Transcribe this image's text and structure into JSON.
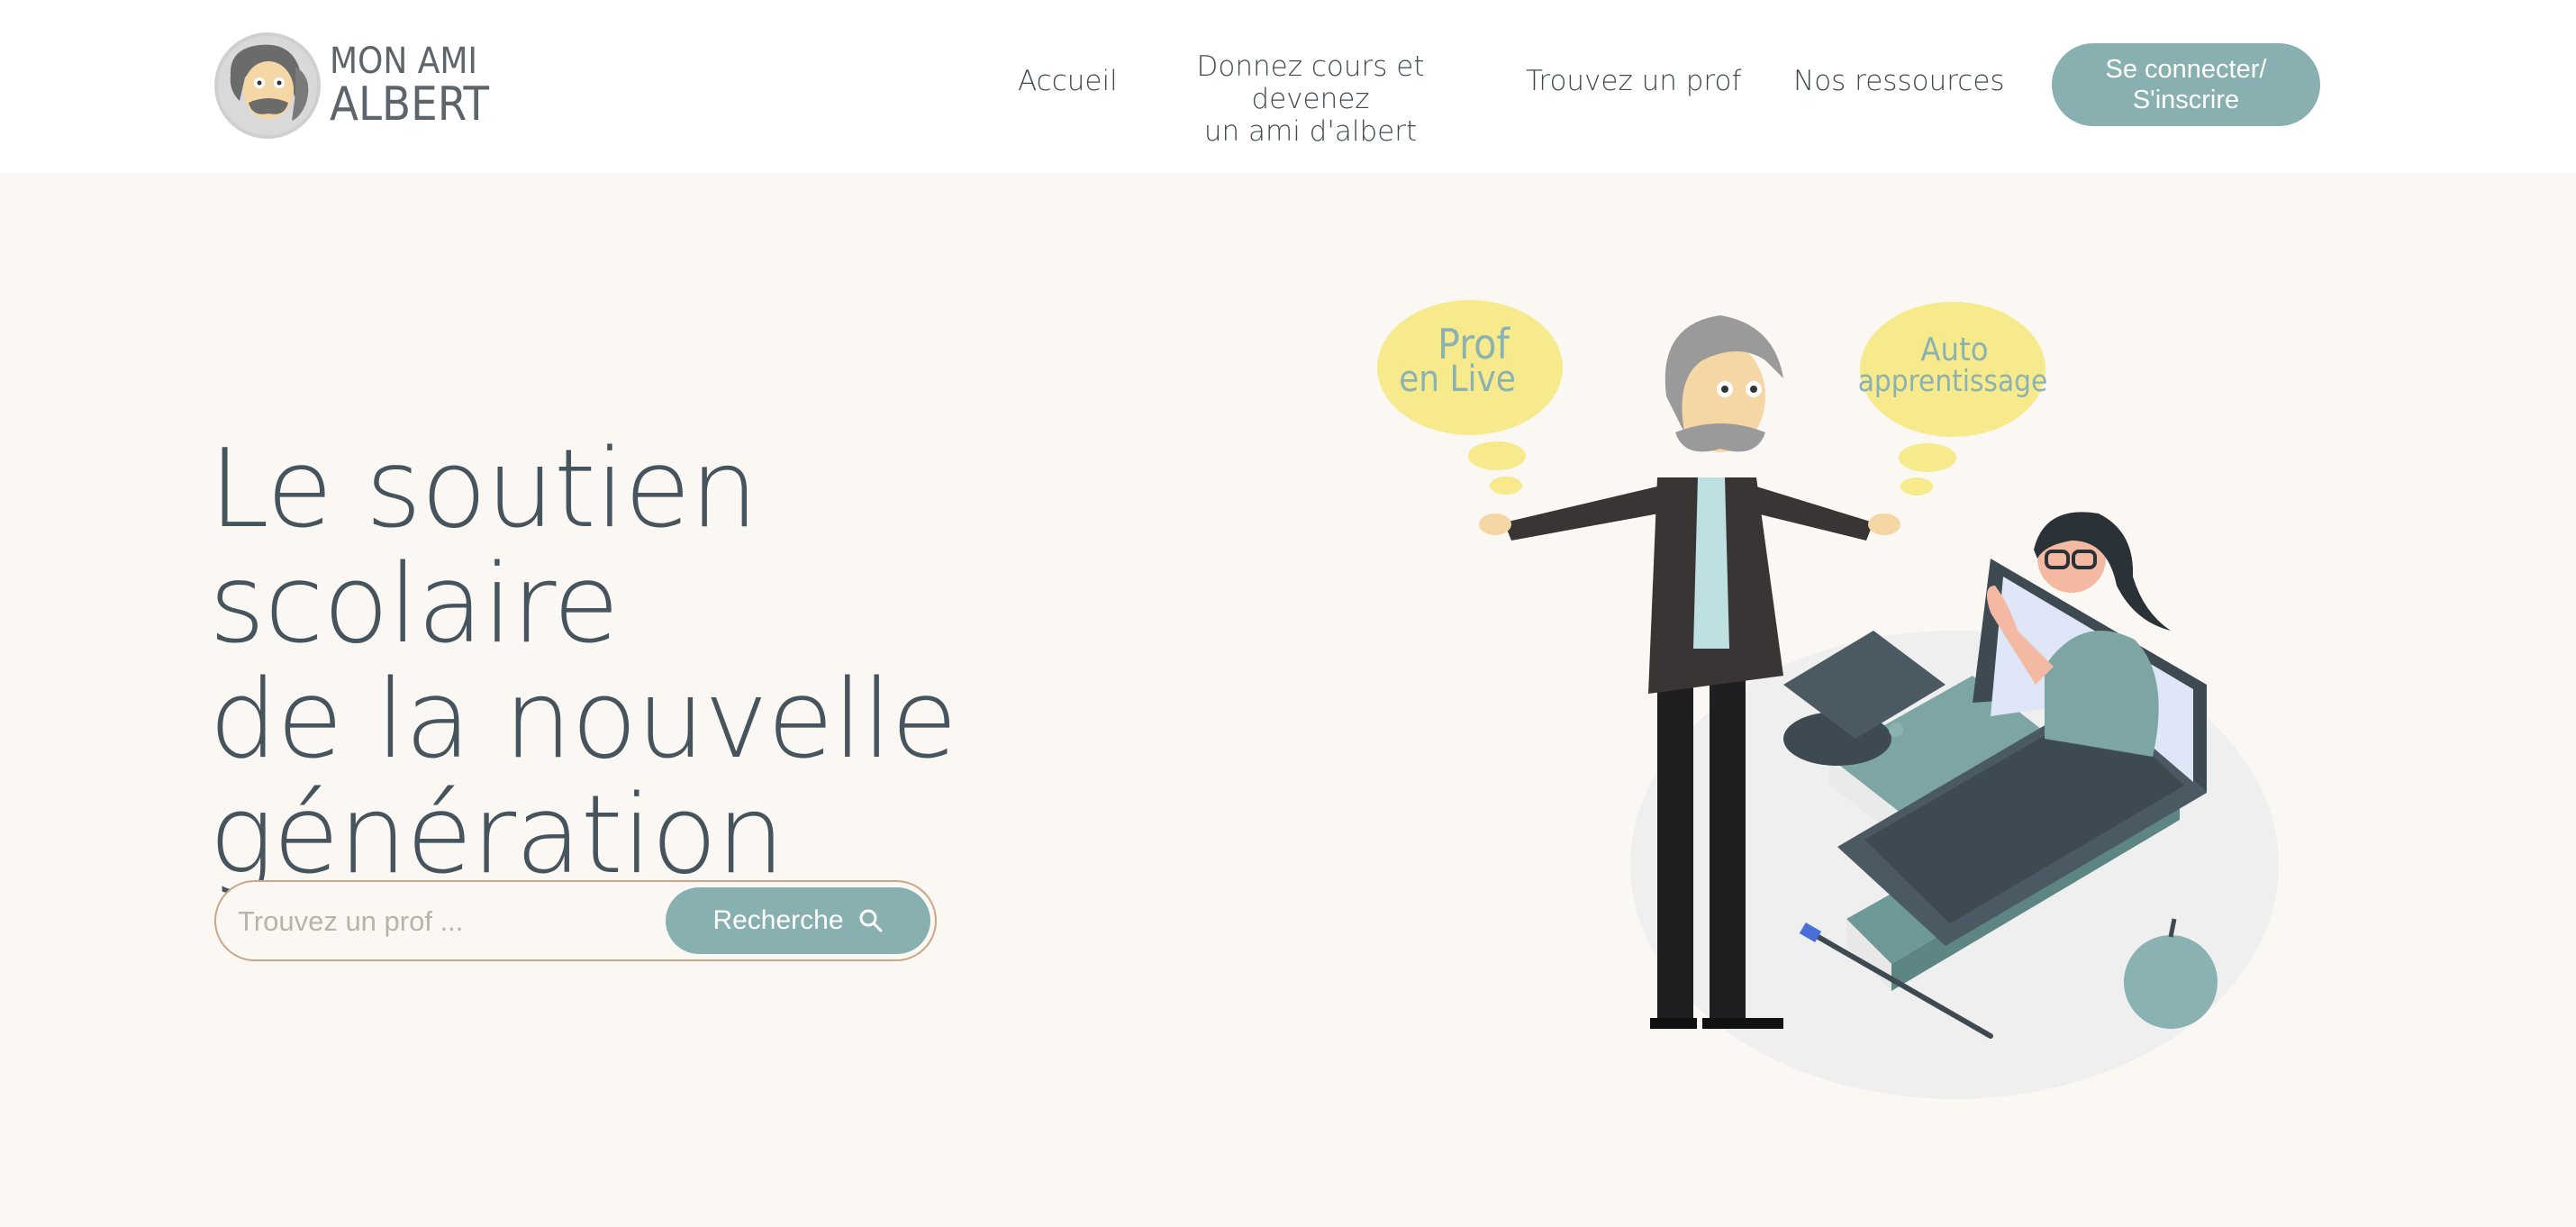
{
  "logo": {
    "line1": "MON AMI",
    "line2": "ALBERT"
  },
  "nav": {
    "accueil": "Accueil",
    "donnez_line1": "Donnez cours et devenez",
    "donnez_line2": "un ami d'albert",
    "trouvez": "Trouvez un prof",
    "ressources": "Nos ressources"
  },
  "login": {
    "line1": "Se connecter/",
    "line2": "S'inscrire"
  },
  "hero": {
    "line1": "Le soutien scolaire",
    "line2": "de la nouvelle",
    "line3": "génération"
  },
  "search": {
    "placeholder": "Trouvez un prof ...",
    "button_label": "Recherche"
  },
  "illustration": {
    "bubble_left_line1": "Prof",
    "bubble_left_line2": "en Live",
    "bubble_right_line1": "Auto",
    "bubble_right_line2": "apprentissage"
  },
  "colors": {
    "accent": "#88b0b0",
    "text": "#46545e",
    "background": "#fbf8f4",
    "bubble": "#f7ea8d"
  }
}
